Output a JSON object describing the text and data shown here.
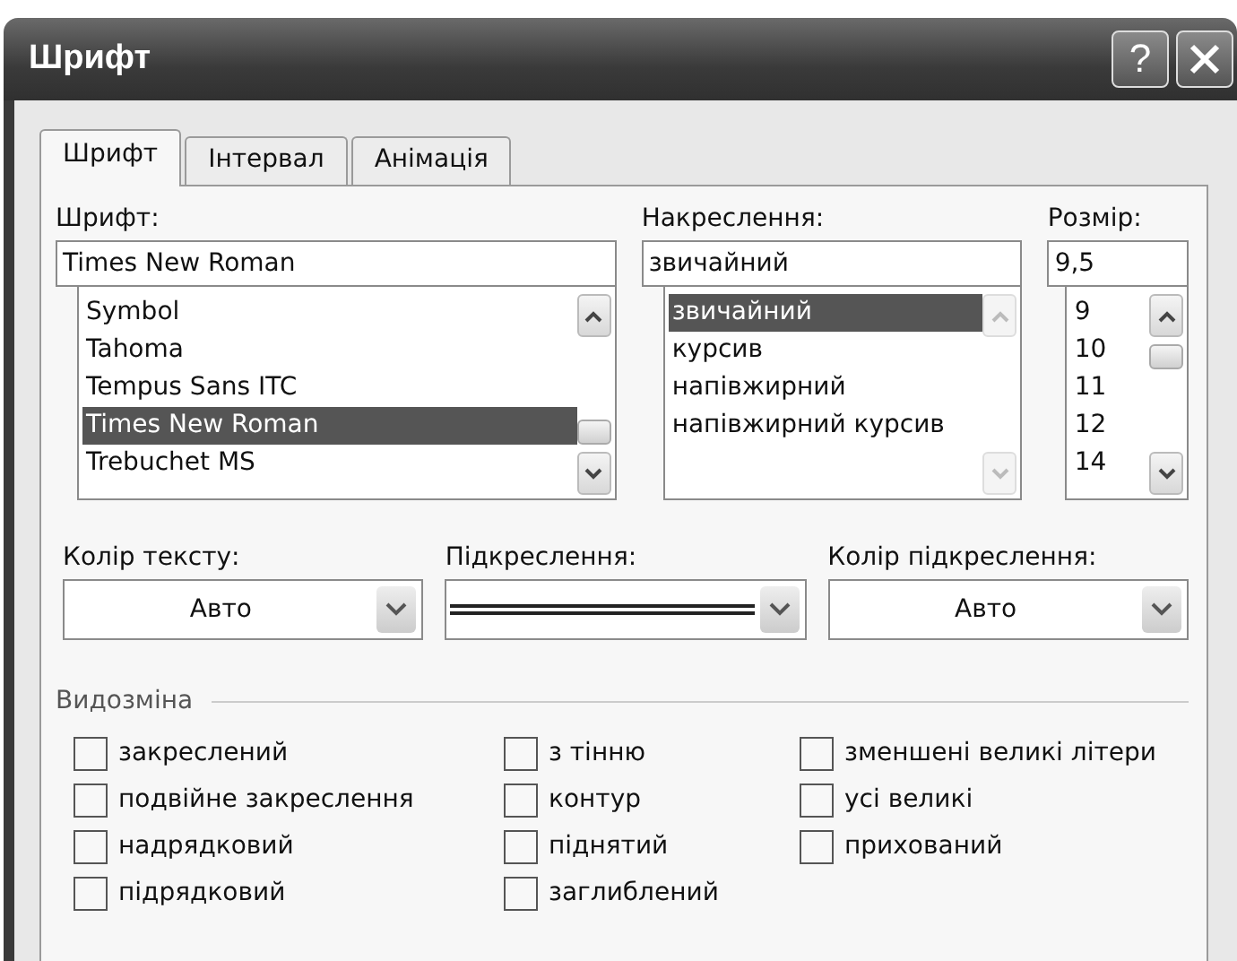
{
  "window": {
    "title": "Шрифт",
    "help_button": "?"
  },
  "tabs": [
    {
      "label": "Шрифт",
      "selected": true
    },
    {
      "label": "Інтервал",
      "selected": false
    },
    {
      "label": "Анімація",
      "selected": false
    }
  ],
  "lists": [
    {
      "label": "Шрифт:",
      "value": "Times New Roman",
      "scrollbar_enabled": true,
      "items": [
        {
          "label": "Symbol",
          "selected": false
        },
        {
          "label": "Tahoma",
          "selected": false
        },
        {
          "label": "Tempus Sans ITC",
          "selected": false
        },
        {
          "label": "Times New Roman",
          "selected": true
        },
        {
          "label": "Trebuchet MS",
          "selected": false
        }
      ]
    },
    {
      "label": "Накреслення:",
      "value": "звичайний",
      "scrollbar_enabled": false,
      "items": [
        {
          "label": "звичайний",
          "selected": true
        },
        {
          "label": "курсив",
          "selected": false
        },
        {
          "label": "напівжирний",
          "selected": false
        },
        {
          "label": "напівжирний курсив",
          "selected": false
        }
      ]
    },
    {
      "label": "Розмір:",
      "value": "9,5",
      "scrollbar_enabled": true,
      "items": [
        {
          "label": "9",
          "selected": false
        },
        {
          "label": "10",
          "selected": false
        },
        {
          "label": "11",
          "selected": false
        },
        {
          "label": "12",
          "selected": false
        },
        {
          "label": "14",
          "selected": false
        }
      ]
    }
  ],
  "dropdowns": [
    {
      "label": "Колір тексту:",
      "kind": "text",
      "value": "Авто"
    },
    {
      "label": "Підкреслення:",
      "kind": "double-line"
    },
    {
      "label": "Колір підкреслення:",
      "kind": "text",
      "value": "Авто"
    }
  ],
  "effects": {
    "title": "Видозміна",
    "columns": [
      [
        {
          "label": "закреслений",
          "checked": false
        },
        {
          "label": "подвійне закреслення",
          "checked": false
        },
        {
          "label": "надрядковий",
          "checked": false
        },
        {
          "label": "підрядковий",
          "checked": false
        }
      ],
      [
        {
          "label": "з тінню",
          "checked": false
        },
        {
          "label": "контур",
          "checked": false
        },
        {
          "label": "піднятий",
          "checked": false
        },
        {
          "label": "заглиблений",
          "checked": false
        }
      ],
      [
        {
          "label": "зменшені великі літери",
          "checked": false
        },
        {
          "label": "усі великі",
          "checked": false
        },
        {
          "label": "прихований",
          "checked": false
        }
      ]
    ]
  }
}
